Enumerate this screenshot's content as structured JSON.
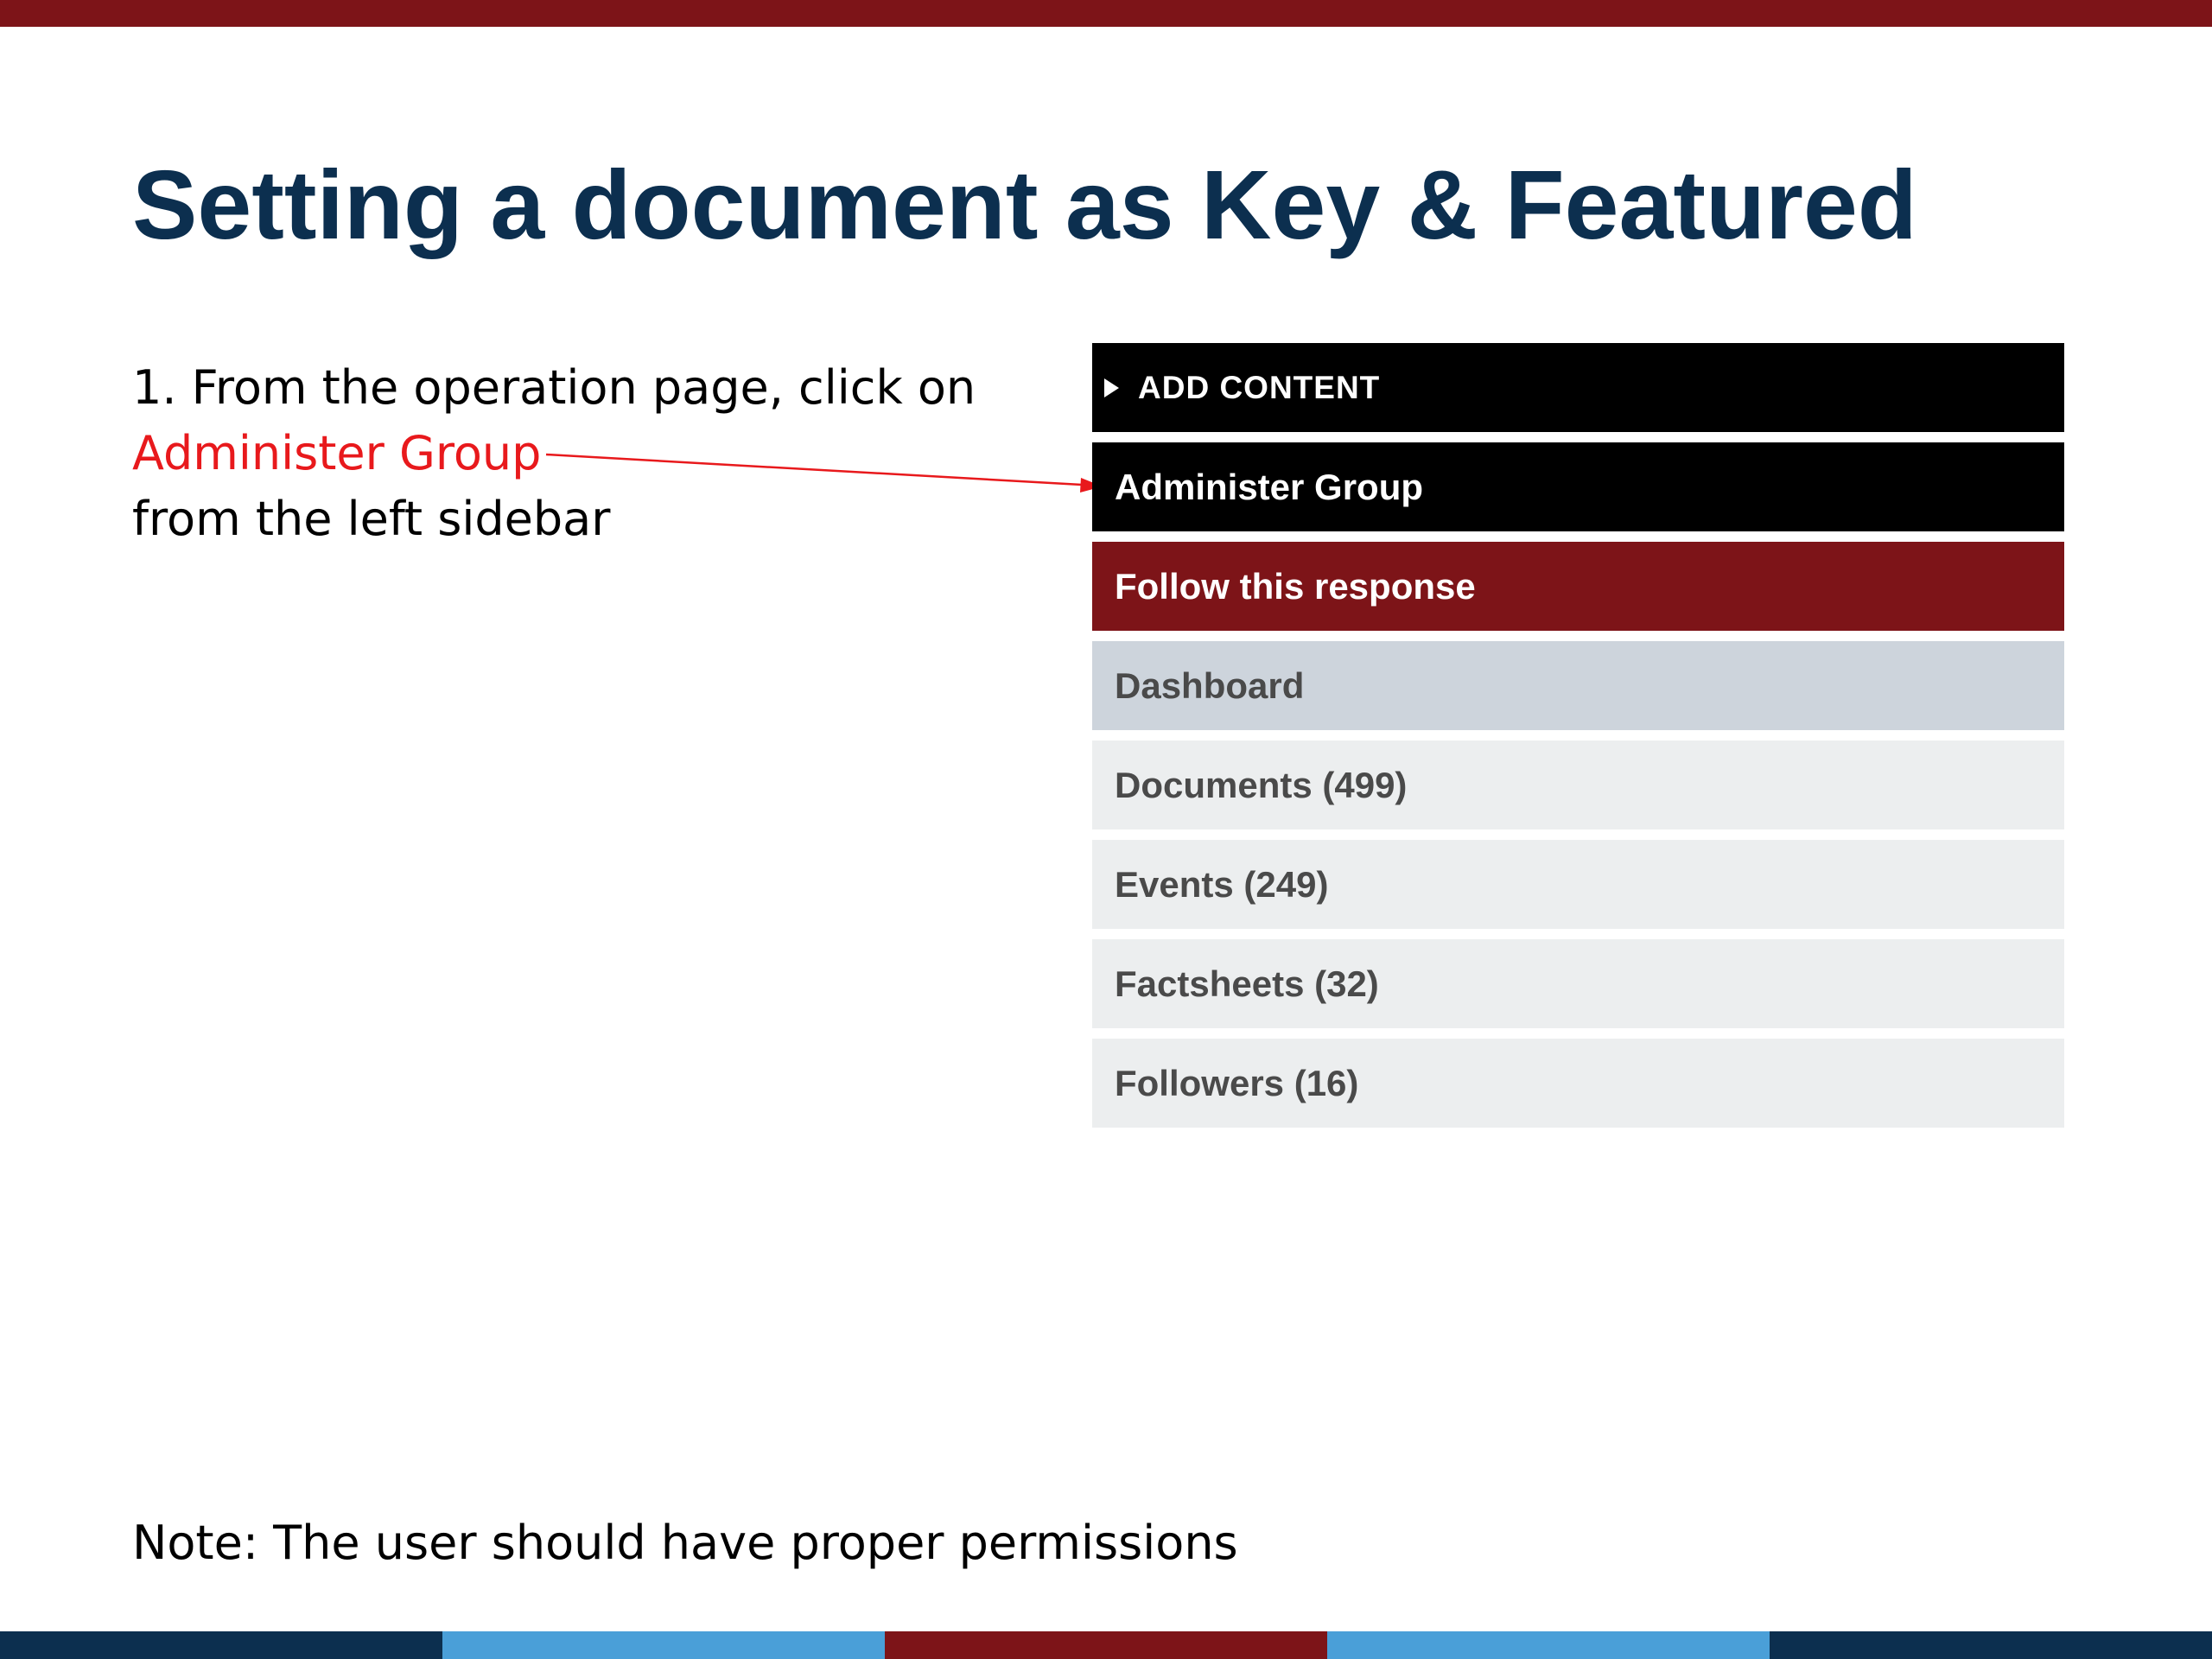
{
  "slide": {
    "title": "Setting a document as Key & Featured",
    "instruction": {
      "line1": "1. From the operation page, click on",
      "highlight": "Administer Group",
      "line3": "from the left sidebar"
    },
    "note": "Note: The user should have proper permissions"
  },
  "sidebar": {
    "add_content": "ADD CONTENT",
    "administer_group": "Administer Group",
    "follow_response": "Follow this response",
    "dashboard": "Dashboard",
    "documents": "Documents (499)",
    "events": "Events (249)",
    "factsheets": "Factsheets (32)",
    "followers": "Followers (16)"
  },
  "colors": {
    "title": "#0c2f4f",
    "accent_red": "#7d1418",
    "highlight_red": "#e8191c",
    "sidebar_dark": "#000000",
    "sidebar_active": "#cdd4dc",
    "sidebar_light": "#eceeef",
    "bottom_stripes": [
      "#0c2f4f",
      "#4a9fd8",
      "#7d1418",
      "#4a9fd8",
      "#0c2f4f"
    ]
  },
  "icons": {
    "add_content": "triangle-right-icon"
  }
}
